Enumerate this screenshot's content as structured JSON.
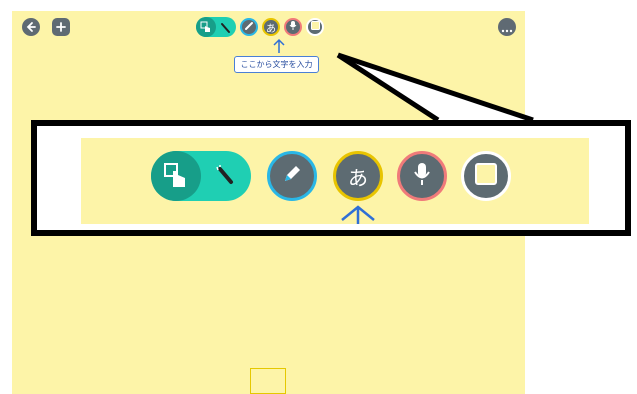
{
  "topbar": {
    "back_icon": "back-arrow-icon",
    "add_icon": "plus-icon",
    "more_icon": "more-dots-icon"
  },
  "toolbar": {
    "tools": [
      {
        "name": "touch-select",
        "icon": "hand-pointer-icon"
      },
      {
        "name": "magic-wand",
        "icon": "magic-wand-icon"
      },
      {
        "name": "pen",
        "icon": "pencil-icon"
      },
      {
        "name": "text-input",
        "icon": "hiragana-a-icon",
        "label": "あ"
      },
      {
        "name": "voice-input",
        "icon": "microphone-icon"
      },
      {
        "name": "shape",
        "icon": "square-icon"
      }
    ]
  },
  "tooltip": {
    "text": "ここから文字を入力"
  },
  "colors": {
    "canvas": "#fdf4a8",
    "teal": "#1fcfb3",
    "pen_ring": "#2ab7e6",
    "text_ring": "#e8c400",
    "mic_ring": "#f07a7a",
    "shape_ring": "#ffffff",
    "arrow": "#2f6fd6"
  }
}
